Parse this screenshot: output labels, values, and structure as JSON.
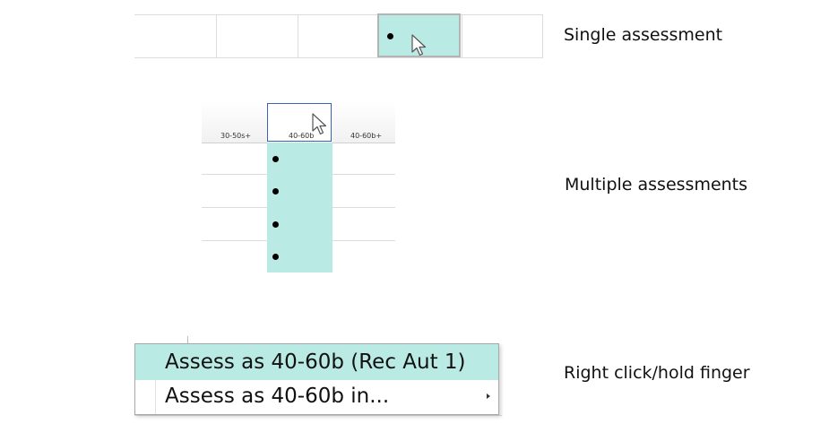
{
  "captions": {
    "single": "Single assessment",
    "multiple": "Multiple assessments",
    "right_click": "Right click/hold finger"
  },
  "grid_headers": [
    "30-50s+",
    "40-60b",
    "40-60b+"
  ],
  "context_menu": {
    "items": [
      {
        "label": "Assess as 40-60b (Rec Aut 1)",
        "highlighted": true
      },
      {
        "label": "Assess as 40-60b in...",
        "has_submenu": true
      }
    ],
    "submenu_arrow": "submenu-arrow-icon"
  },
  "colors": {
    "selection": "#b9ebe4",
    "header_border": "#3a62b5",
    "grid": "#dcdcdc"
  },
  "icons": [
    "pointer-cursor-icon",
    "bullet-dot-icon"
  ]
}
